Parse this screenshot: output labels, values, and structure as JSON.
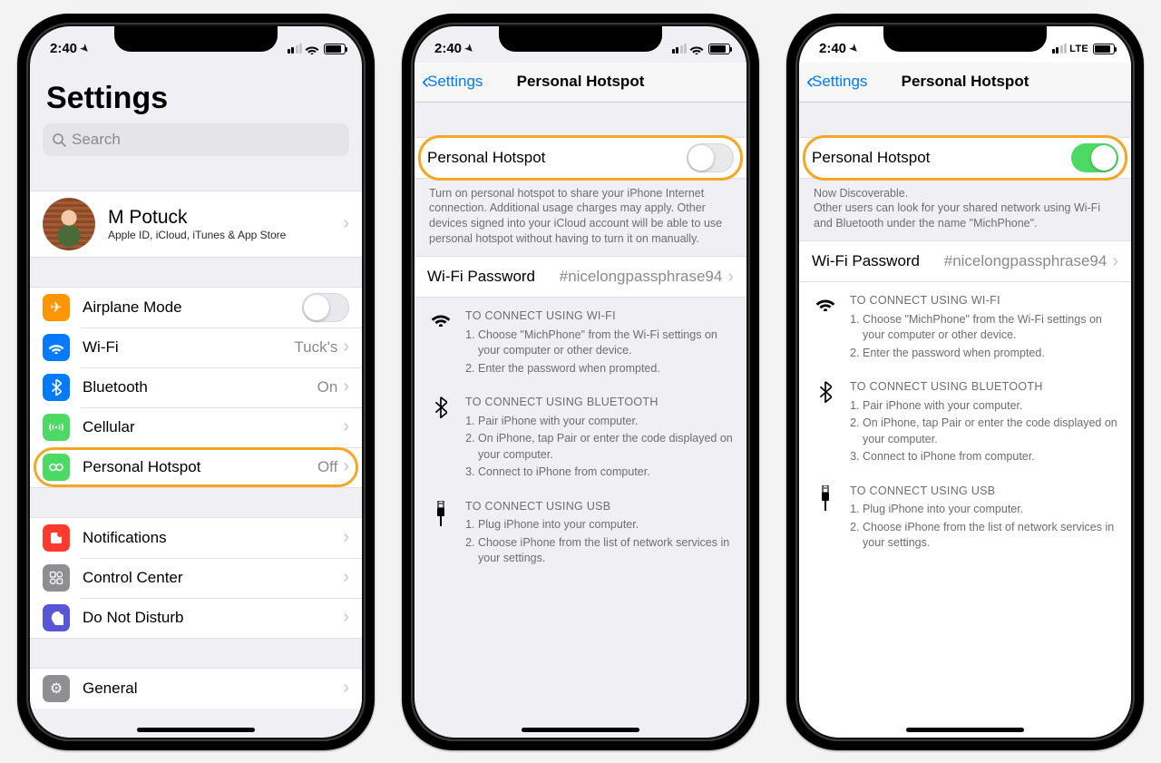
{
  "status": {
    "time": "2:40",
    "network": "LTE"
  },
  "screen1": {
    "title": "Settings",
    "search_placeholder": "Search",
    "profile_name": "M Potuck",
    "profile_sub": "Apple ID, iCloud, iTunes & App Store",
    "rows": {
      "airplane": "Airplane Mode",
      "wifi": "Wi-Fi",
      "wifi_value": "Tuck's",
      "bluetooth": "Bluetooth",
      "bluetooth_value": "On",
      "cellular": "Cellular",
      "hotspot": "Personal Hotspot",
      "hotspot_value": "Off",
      "notifications": "Notifications",
      "control_center": "Control Center",
      "dnd": "Do Not Disturb",
      "general": "General"
    }
  },
  "hotspot": {
    "nav_back": "Settings",
    "nav_title": "Personal Hotspot",
    "toggle_label": "Personal Hotspot",
    "footer_off": "Turn on personal hotspot to share your iPhone Internet connection. Additional usage charges may apply. Other devices signed into your iCloud account will be able to use personal hotspot without having to turn it on manually.",
    "discoverable_title": "Now Discoverable.",
    "discoverable_body": "Other users can look for your shared network using Wi-Fi and Bluetooth under the name \"MichPhone\".",
    "wifi_password_label": "Wi-Fi Password",
    "wifi_password_value": "#nicelongpassphrase94",
    "wifi_title": "TO CONNECT USING WI-FI",
    "wifi_step1": "Choose \"MichPhone\" from the Wi-Fi settings on your computer or other device.",
    "wifi_step2": "Enter the password when prompted.",
    "bt_title": "TO CONNECT USING BLUETOOTH",
    "bt_step1": "Pair iPhone with your computer.",
    "bt_step2": "On iPhone, tap Pair or enter the code displayed on your computer.",
    "bt_step3": "Connect to iPhone from computer.",
    "usb_title": "TO CONNECT USING USB",
    "usb_step1": "Plug iPhone into your computer.",
    "usb_step2": "Choose iPhone from the list of network services in your settings."
  },
  "colors": {
    "highlight": "#f5a623",
    "orange": "#ff9500",
    "blue": "#007aff",
    "green": "#4cd964",
    "red": "#ff3b30",
    "gray": "#8e8e93",
    "purple": "#5856d6"
  }
}
